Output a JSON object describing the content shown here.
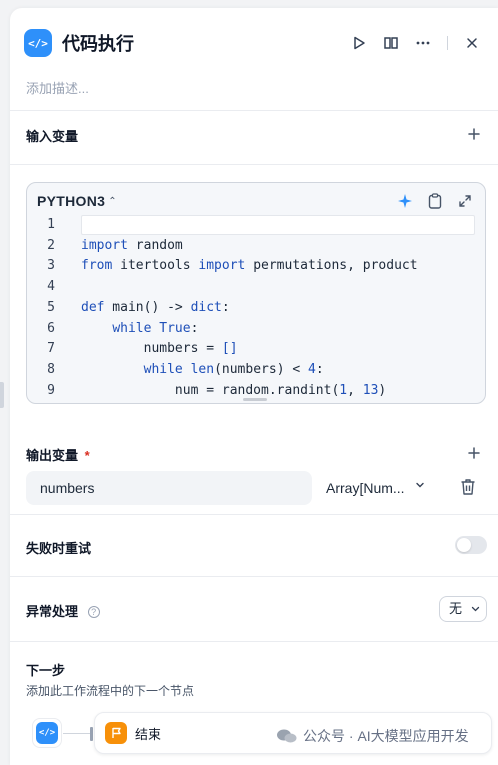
{
  "header": {
    "title": "代码执行",
    "icon_text": "</>",
    "accent": "#2e90fa"
  },
  "description_placeholder": "添加描述...",
  "input_section": {
    "title": "输入变量"
  },
  "code": {
    "language": "PYTHON3",
    "lines": [
      {
        "num": "1",
        "tokens": []
      },
      {
        "num": "2",
        "tokens": [
          {
            "t": "import",
            "k": "kw"
          },
          {
            "t": " random",
            "k": ""
          }
        ]
      },
      {
        "num": "3",
        "tokens": [
          {
            "t": "from",
            "k": "kw"
          },
          {
            "t": " itertools ",
            "k": ""
          },
          {
            "t": "import",
            "k": "kw"
          },
          {
            "t": " permutations, product",
            "k": ""
          }
        ]
      },
      {
        "num": "4",
        "tokens": []
      },
      {
        "num": "5",
        "tokens": [
          {
            "t": "def",
            "k": "kw"
          },
          {
            "t": " main() -> ",
            "k": ""
          },
          {
            "t": "dict",
            "k": "kw"
          },
          {
            "t": ":",
            "k": ""
          }
        ]
      },
      {
        "num": "6",
        "tokens": [
          {
            "t": "    ",
            "k": ""
          },
          {
            "t": "while",
            "k": "kw"
          },
          {
            "t": " ",
            "k": ""
          },
          {
            "t": "True",
            "k": "kw"
          },
          {
            "t": ":",
            "k": ""
          }
        ]
      },
      {
        "num": "7",
        "tokens": [
          {
            "t": "        numbers = ",
            "k": ""
          },
          {
            "t": "[]",
            "k": "kw"
          }
        ]
      },
      {
        "num": "8",
        "tokens": [
          {
            "t": "        ",
            "k": ""
          },
          {
            "t": "while",
            "k": "kw"
          },
          {
            "t": " ",
            "k": ""
          },
          {
            "t": "len",
            "k": "kw"
          },
          {
            "t": "(numbers) < ",
            "k": ""
          },
          {
            "t": "4",
            "k": "kw"
          },
          {
            "t": ":",
            "k": ""
          }
        ]
      },
      {
        "num": "9",
        "tokens": [
          {
            "t": "            num = random.randint(",
            "k": ""
          },
          {
            "t": "1",
            "k": "kw"
          },
          {
            "t": ", ",
            "k": ""
          },
          {
            "t": "13",
            "k": "kw"
          },
          {
            "t": ")",
            "k": ""
          }
        ]
      }
    ]
  },
  "output_section": {
    "title": "输出变量",
    "required_mark": "*",
    "variable_name": "numbers",
    "variable_type": "Array[Num..."
  },
  "retry": {
    "label": "失败时重试",
    "enabled": false
  },
  "error_handling": {
    "label": "异常处理",
    "value": "无"
  },
  "next_step": {
    "title": "下一步",
    "subtitle": "添加此工作流程中的下一个节点",
    "node_label": "结束"
  },
  "watermark": "公众号 · AI大模型应用开发"
}
